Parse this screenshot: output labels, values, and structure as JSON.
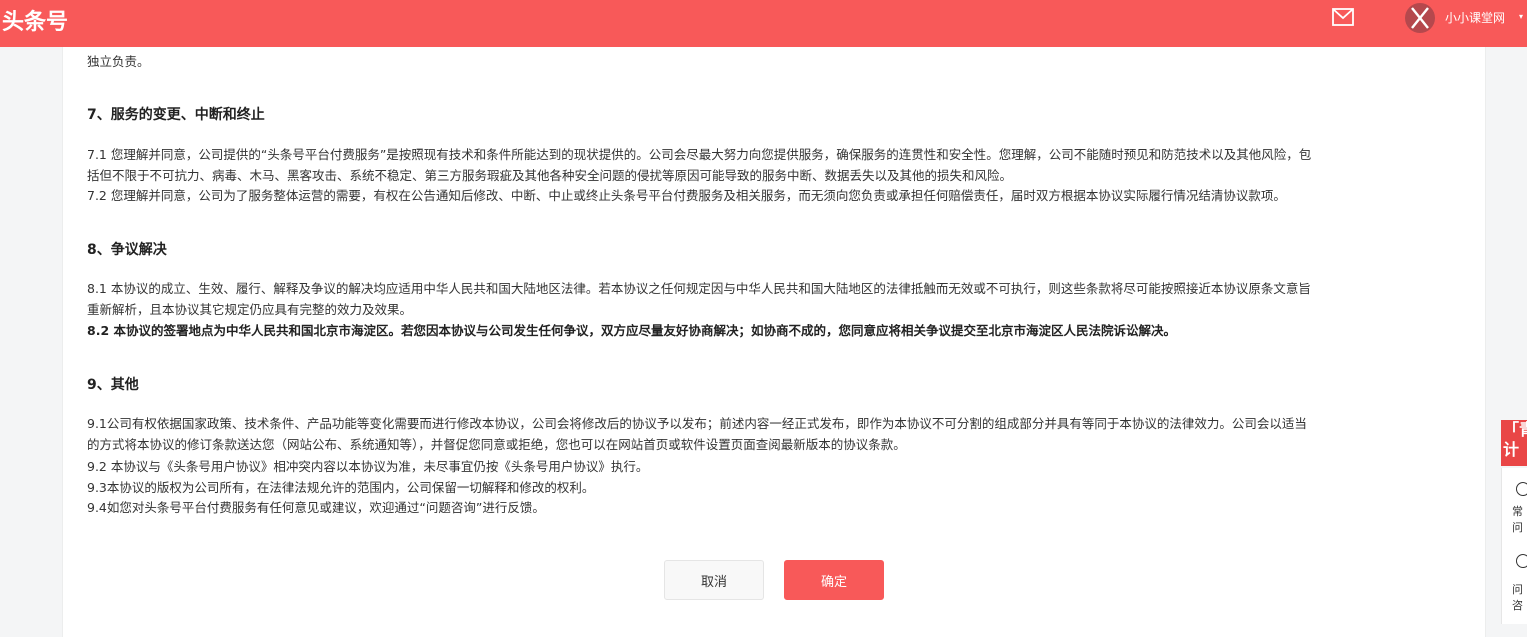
{
  "header": {
    "logo": "头条号",
    "username": "小小课堂网",
    "caret": "▾",
    "bg_color": "#f85959"
  },
  "content": {
    "line_top": "独立负责。",
    "s7": {
      "title": "7、服务的变更、中断和终止",
      "p1a": "7.1 您理解并同意，公司提供的“头条号平台付费服务”是按照现有技术和条件所能达到的现状提供的。公司会尽最大努力向您提供服务，确保服务的连贯性和安全性。您理解，公司不能随时预见和防范技术以及其他风险，包",
      "p1b": "括但不限于不可抗力、病毒、木马、黑客攻击、系统不稳定、第三方服务瑕疵及其他各种安全问题的侵扰等原因可能导致的服务中断、数据丢失以及其他的损失和风险。",
      "p2": "7.2 您理解并同意，公司为了服务整体运营的需要，有权在公告通知后修改、中断、中止或终止头条号平台付费服务及相关服务，而无须向您负责或承担任何赔偿责任，届时双方根据本协议实际履行情况结清协议款项。"
    },
    "s8": {
      "title": "8、争议解决",
      "p1a": "8.1 本协议的成立、生效、履行、解释及争议的解决均应适用中华人民共和国大陆地区法律。若本协议之任何规定因与中华人民共和国大陆地区的法律抵触而无效或不可执行，则这些条款将尽可能按照接近本协议原条文意旨",
      "p1b": "重新解析，且本协议其它规定仍应具有完整的效力及效果。",
      "p2": "8.2 本协议的签署地点为中华人民共和国北京市海淀区。若您因本协议与公司发生任何争议，双方应尽量友好协商解决；如协商不成的，您同意应将相关争议提交至北京市海淀区人民法院诉讼解决。"
    },
    "s9": {
      "title": "9、其他",
      "p1a": "9.1公司有权依据国家政策、技术条件、产品功能等变化需要而进行修改本协议，公司会将修改后的协议予以发布；前述内容一经正式发布，即作为本协议不可分割的组成部分并具有等同于本协议的法律效力。公司会以适当",
      "p1b": "的方式将本协议的修订条款送达您（网站公布、系统通知等），并督促您同意或拒绝，您也可以在网站首页或软件设置页面查阅最新版本的协议条款。",
      "p2": "9.2 本协议与《头条号用户协议》相冲突内容以本协议为准，未尽事宜仍按《头条号用户协议》执行。",
      "p3": "9.3本协议的版权为公司所有，在法律法规允许的范围内，公司保留一切解释和修改的权利。",
      "p4": "9.4如您对头条号平台付费服务有任何意见或建议，欢迎通过“问题咨询”进行反馈。"
    }
  },
  "buttons": {
    "cancel": "取消",
    "ok": "确定"
  },
  "side": {
    "banner_line1": "「青",
    "banner_line2": "计",
    "faq_1": "常",
    "faq_2": "问",
    "consult_1": "问",
    "consult_2": "咨"
  }
}
